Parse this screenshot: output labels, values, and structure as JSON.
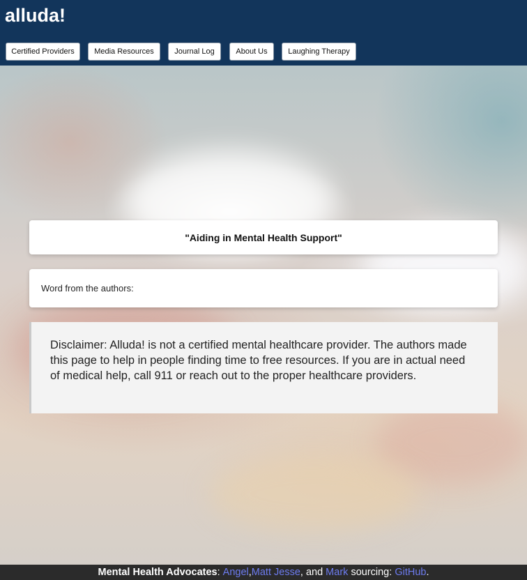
{
  "header": {
    "brand": "alluda!",
    "nav": [
      {
        "label": "Certified Providers"
      },
      {
        "label": "Media Resources"
      },
      {
        "label": "Journal Log"
      },
      {
        "label": "About Us"
      },
      {
        "label": "Laughing Therapy"
      }
    ]
  },
  "main": {
    "tagline": "\"Aiding in Mental Health Support\"",
    "word_from_authors": "Word from the authors:",
    "disclaimer": "Disclaimer: Alluda! is not a certified mental healthcare provider. The authors made this page to help in people finding time to free resources. If you are in actual need of medical help, call 911 or reach out to the proper healthcare providers."
  },
  "footer": {
    "label": "Mental Health Advocates",
    "colon": ":",
    "link1": "Angel",
    "comma": ",",
    "link2": "Matt Jesse",
    "and_text": ", and",
    "link3": "Mark",
    "sourcing": "sourcing:",
    "link4": "GitHub",
    "period": "."
  },
  "colors": {
    "header_bg": "#12355b",
    "footer_bg": "#2b2b2b",
    "link": "#6d7cf0"
  }
}
